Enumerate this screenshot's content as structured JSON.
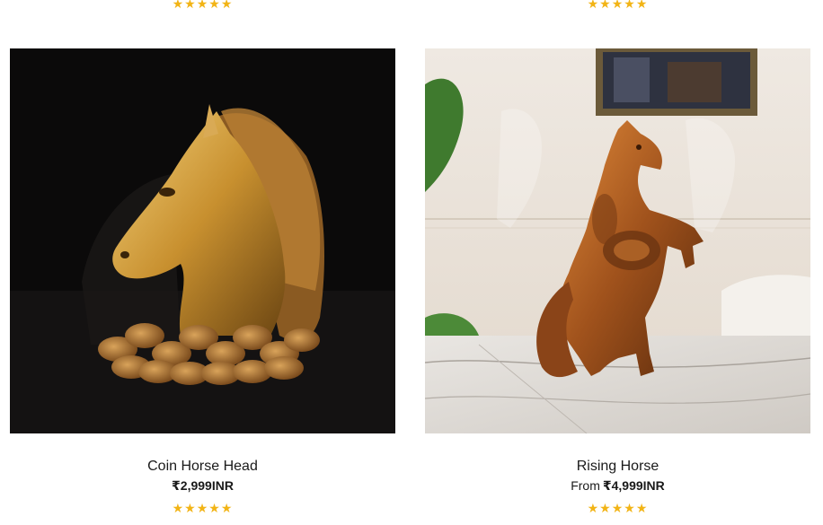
{
  "rating_stars": "★★★★★",
  "accent_star_color": "#f2b416",
  "products": [
    {
      "title": "Coin Horse Head",
      "price_prefix": "",
      "price": "₹2,999INR",
      "image_icon": "golden-horse-head-statue-image"
    },
    {
      "title": "Rising Horse",
      "price_prefix": "From",
      "price": "₹4,999INR",
      "image_icon": "rising-horse-statue-image"
    }
  ]
}
